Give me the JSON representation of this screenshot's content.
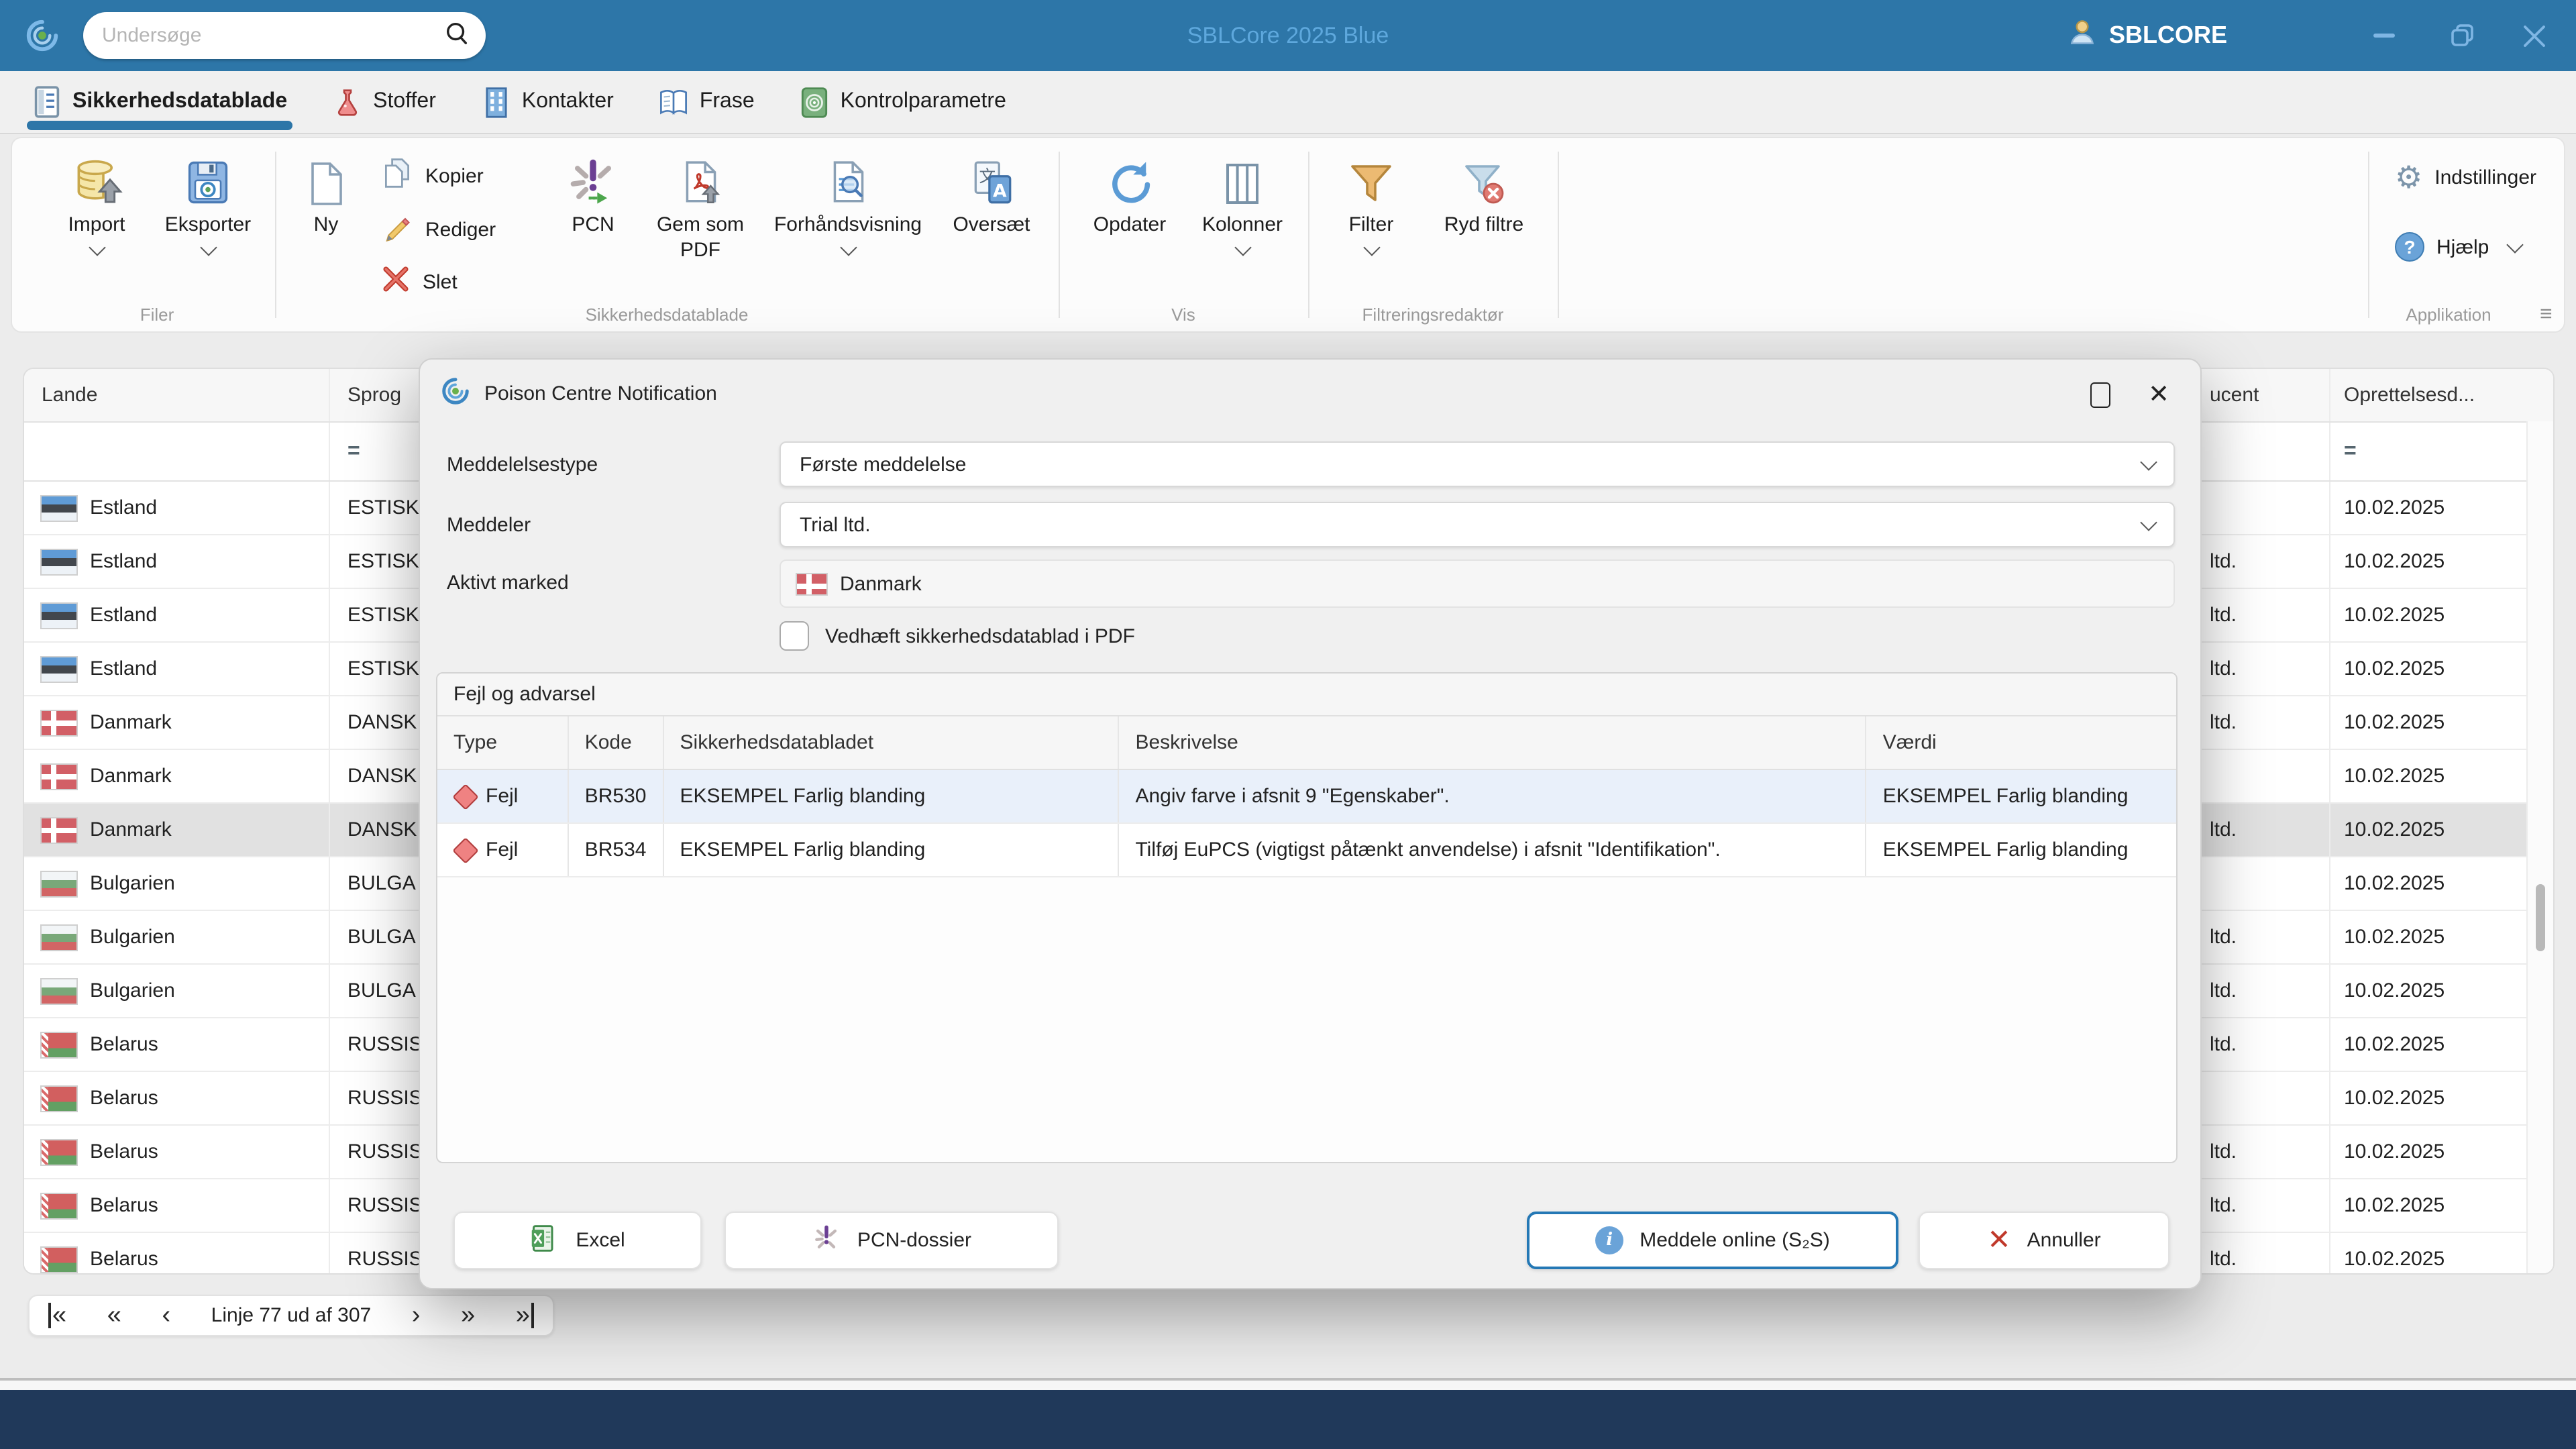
{
  "titlebar": {
    "search_placeholder": "Undersøge",
    "app_title": "SBLCore 2025 Blue",
    "account_label": "SBLCORE",
    "accent_color": "#2d76a8"
  },
  "tabs": [
    {
      "label": "Sikkerhedsdatablade",
      "icon": "datasheet-document-icon",
      "active": true
    },
    {
      "label": "Stoffer",
      "icon": "flask-icon",
      "active": false
    },
    {
      "label": "Kontakter",
      "icon": "building-icon",
      "active": false
    },
    {
      "label": "Frase",
      "icon": "book-icon",
      "active": false
    },
    {
      "label": "Kontrolparametre",
      "icon": "target-icon",
      "active": false
    }
  ],
  "ribbon": {
    "groups": [
      {
        "label": "Filer",
        "items": [
          {
            "label": "Import",
            "icon": "database-import-icon",
            "chevron": true
          },
          {
            "label": "Eksporter",
            "icon": "floppy-export-icon",
            "chevron": true
          }
        ]
      },
      {
        "label": "Sikkerhedsdatablade",
        "items": [
          {
            "label": "Ny",
            "icon": "new-document-icon"
          },
          {
            "label": "Kopier",
            "icon": "copy-icon"
          },
          {
            "label": "Rediger",
            "icon": "pencil-icon"
          },
          {
            "label": "Slet",
            "icon": "delete-x-icon"
          },
          {
            "label": "PCN",
            "icon": "pcn-asterisk-icon"
          },
          {
            "label": "Gem som PDF",
            "icon": "pdf-download-icon"
          },
          {
            "label": "Forhåndsvisning",
            "icon": "preview-magnifier-icon",
            "chevron": true
          },
          {
            "label": "Oversæt",
            "icon": "translate-icon"
          }
        ]
      },
      {
        "label": "Vis",
        "items": [
          {
            "label": "Opdater",
            "icon": "refresh-icon"
          },
          {
            "label": "Kolonner",
            "icon": "columns-icon",
            "chevron": true
          }
        ]
      },
      {
        "label": "Filtreringsredaktør",
        "items": [
          {
            "label": "Filter",
            "icon": "filter-funnel-icon",
            "chevron": true
          },
          {
            "label": "Ryd filtre",
            "icon": "clear-filter-icon"
          }
        ]
      },
      {
        "label": "Applikation",
        "items": [
          {
            "label": "Indstillinger",
            "icon": "gear-icon"
          },
          {
            "label": "Hjælp",
            "icon": "help-icon",
            "chevron": true
          }
        ],
        "launcher_icon": "menu-icon"
      }
    ]
  },
  "table": {
    "columns": {
      "lande": "Lande",
      "sprog": "Sprog",
      "producent_clipped": "ucent",
      "oprettelsesdato": "Oprettelsesd..."
    },
    "filter_equals": "=",
    "rows": [
      {
        "country": "Estland",
        "flag": "estonia-flag-icon",
        "sprog": "ESTISK",
        "producent": "",
        "date": "10.02.2025",
        "selected": false
      },
      {
        "country": "Estland",
        "flag": "estonia-flag-icon",
        "sprog": "ESTISK",
        "producent": "ltd.",
        "date": "10.02.2025",
        "selected": false
      },
      {
        "country": "Estland",
        "flag": "estonia-flag-icon",
        "sprog": "ESTISK",
        "producent": "ltd.",
        "date": "10.02.2025",
        "selected": false
      },
      {
        "country": "Estland",
        "flag": "estonia-flag-icon",
        "sprog": "ESTISK",
        "producent": "ltd.",
        "date": "10.02.2025",
        "selected": false
      },
      {
        "country": "Danmark",
        "flag": "denmark-flag-icon",
        "sprog": "DANSK",
        "producent": "ltd.",
        "date": "10.02.2025",
        "selected": false
      },
      {
        "country": "Danmark",
        "flag": "denmark-flag-icon",
        "sprog": "DANSK",
        "producent": "",
        "date": "10.02.2025",
        "selected": false
      },
      {
        "country": "Danmark",
        "flag": "denmark-flag-icon",
        "sprog": "DANSK",
        "producent": "ltd.",
        "date": "10.02.2025",
        "selected": true
      },
      {
        "country": "Bulgarien",
        "flag": "bulgaria-flag-icon",
        "sprog": "BULGA",
        "producent": "",
        "date": "10.02.2025",
        "selected": false
      },
      {
        "country": "Bulgarien",
        "flag": "bulgaria-flag-icon",
        "sprog": "BULGA",
        "producent": "ltd.",
        "date": "10.02.2025",
        "selected": false
      },
      {
        "country": "Bulgarien",
        "flag": "bulgaria-flag-icon",
        "sprog": "BULGA",
        "producent": "ltd.",
        "date": "10.02.2025",
        "selected": false
      },
      {
        "country": "Belarus",
        "flag": "belarus-flag-icon",
        "sprog": "RUSSIS",
        "producent": "ltd.",
        "date": "10.02.2025",
        "selected": false
      },
      {
        "country": "Belarus",
        "flag": "belarus-flag-icon",
        "sprog": "RUSSIS",
        "producent": "",
        "date": "10.02.2025",
        "selected": false
      },
      {
        "country": "Belarus",
        "flag": "belarus-flag-icon",
        "sprog": "RUSSIS",
        "producent": "ltd.",
        "date": "10.02.2025",
        "selected": false
      },
      {
        "country": "Belarus",
        "flag": "belarus-flag-icon",
        "sprog": "RUSSIS",
        "producent": "ltd.",
        "date": "10.02.2025",
        "selected": false
      },
      {
        "country": "Belarus",
        "flag": "belarus-flag-icon",
        "sprog": "RUSSIS",
        "producent": "ltd.",
        "date": "10.02.2025",
        "selected": false
      }
    ]
  },
  "pagination": {
    "label": "Linje 77 ud af 307",
    "icons": [
      "first-page-icon",
      "fast-previous-icon",
      "previous-icon",
      "next-icon",
      "fast-next-icon",
      "last-page-icon"
    ]
  },
  "dialog": {
    "title": "Poison Centre Notification",
    "fields": [
      {
        "label": "Meddelelsestype",
        "value": "Første meddelelse",
        "type": "select"
      },
      {
        "label": "Meddeler",
        "value": "Trial ltd.",
        "type": "select"
      },
      {
        "label": "Aktivt marked",
        "value": "Danmark",
        "flag": "denmark-flag-icon",
        "type": "readonly"
      }
    ],
    "checkbox": {
      "label": "Vedhæft sikkerhedsdatablad i PDF",
      "checked": false
    },
    "fieldset": {
      "title": "Fejl og advarsel",
      "columns": [
        "Type",
        "Kode",
        "Sikkerhedsdatabladet",
        "Beskrivelse",
        "Værdi"
      ],
      "rows": [
        {
          "type": "Fejl",
          "icon": "error-diamond-icon",
          "code": "BR530",
          "sds": "EKSEMPEL Farlig blanding",
          "description": "Angiv farve i afsnit 9 \"Egenskaber\".",
          "value": "EKSEMPEL Farlig blanding",
          "highlighted": true
        },
        {
          "type": "Fejl",
          "icon": "error-diamond-icon",
          "code": "BR534",
          "sds": "EKSEMPEL Farlig blanding",
          "description": "Tilføj EuPCS (vigtigst påtænkt anvendelse) i afsnit \"Identifikation\".",
          "value": "EKSEMPEL Farlig blanding",
          "highlighted": false
        }
      ]
    },
    "buttons": [
      {
        "label": "Excel",
        "icon": "excel-icon",
        "primary": false
      },
      {
        "label": "PCN-dossier",
        "icon": "pcn-asterisk-icon",
        "primary": false
      },
      {
        "label": "Meddele online (S₂S)",
        "icon": "info-icon",
        "primary": true
      },
      {
        "label": "Annuller",
        "icon": "red-x-icon",
        "primary": false
      }
    ]
  }
}
